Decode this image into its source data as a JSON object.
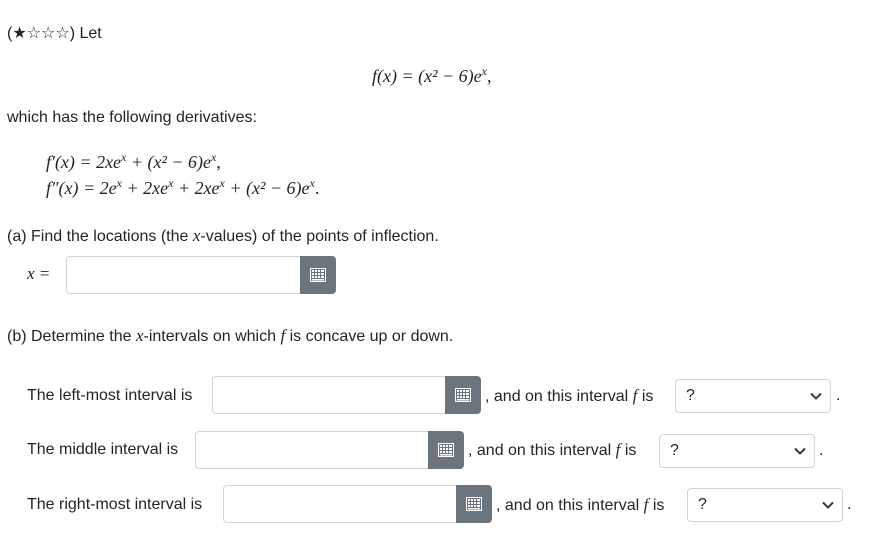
{
  "header": {
    "difficulty": "(★☆☆☆)",
    "intro": "Let"
  },
  "main_function": {
    "lhs": "f(x) = (x² − 6)e",
    "exp": "x",
    "tail": ","
  },
  "derivatives_intro": "which has the following derivatives:",
  "derivatives": {
    "first": {
      "a": "f′(x) = 2xe",
      "e1": "x",
      "b": " + (x² − 6)e",
      "e2": "x",
      "c": ","
    },
    "second": {
      "a": "f″(x) = 2e",
      "e1": "x",
      "b": " + 2xe",
      "e2": "x",
      "c": " + 2xe",
      "e3": "x",
      "d": " + (x² − 6)e",
      "e4": "x",
      "e": "."
    }
  },
  "part_a": {
    "question": "(a) Find the locations (the x-values) of the points of inflection.",
    "q_pre": "(a) Find the locations (the ",
    "q_var": "x",
    "q_post": "-values) of the points of inflection.",
    "label": "x =",
    "value": ""
  },
  "part_b": {
    "q_pre": "(b) Determine the ",
    "q_var": "x",
    "q_mid": "-intervals on which ",
    "q_f": "f",
    "q_post": " is concave up or down.",
    "rows": [
      {
        "label": "The left-most interval is",
        "value": "",
        "mid_pre": ", and on this interval ",
        "mid_f": "f",
        "mid_post": " is",
        "select": "?"
      },
      {
        "label": "The middle interval is",
        "value": "",
        "mid_pre": ", and on this interval ",
        "mid_f": "f",
        "mid_post": " is",
        "select": "?"
      },
      {
        "label": "The right-most interval is",
        "value": "",
        "mid_pre": ", and on this interval ",
        "mid_f": "f",
        "mid_post": " is",
        "select": "?"
      }
    ],
    "period": "."
  },
  "icons": {
    "math_button": "math-editor-icon",
    "dropdown": "chevron-down-icon"
  },
  "colors": {
    "button_bg": "#6c757d",
    "border": "#ced4da",
    "text": "#212529"
  }
}
